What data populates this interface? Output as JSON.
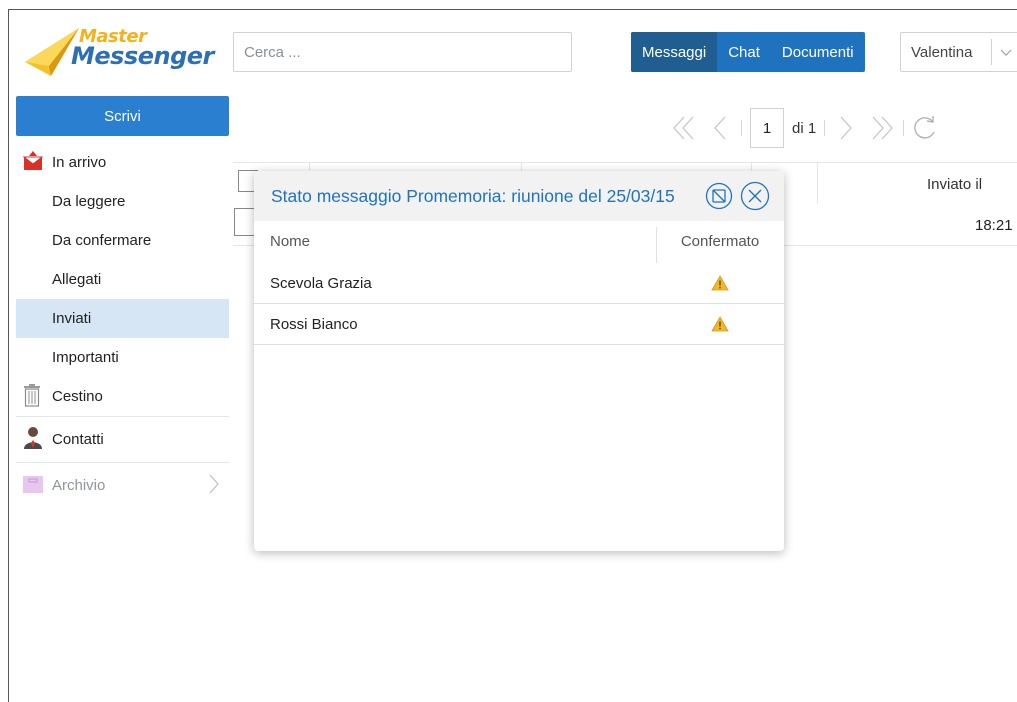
{
  "app": {
    "logo_word1": "Master",
    "logo_word2": "Messenger"
  },
  "search": {
    "placeholder": "Cerca ..."
  },
  "tabs": [
    {
      "label": "Messaggi",
      "active": true
    },
    {
      "label": "Chat",
      "active": false
    },
    {
      "label": "Documenti",
      "active": false
    }
  ],
  "user": {
    "name": "Valentina"
  },
  "sidebar": {
    "compose_label": "Scrivi",
    "items": [
      {
        "label": "In arrivo",
        "icon": "inbox-envelope-icon"
      },
      {
        "label": "Da leggere"
      },
      {
        "label": "Da confermare"
      },
      {
        "label": "Allegati"
      },
      {
        "label": "Inviati",
        "active": true
      },
      {
        "label": "Importanti"
      },
      {
        "label": "Cestino",
        "icon": "trash-icon"
      },
      {
        "label": "Contatti",
        "icon": "contacts-person-icon"
      },
      {
        "label": "Archivio",
        "icon": "archive-folder-icon"
      }
    ]
  },
  "pager": {
    "page": "1",
    "total_label": "di 1"
  },
  "list": {
    "col_sent": "Inviato il",
    "row_time": "18:21"
  },
  "modal": {
    "title": "Stato messaggio Promemoria: riunione del 25/03/15",
    "col_name": "Nome",
    "col_confirmed": "Confermato",
    "rows": [
      {
        "name": "Scevola Grazia",
        "status_icon": "warning-icon"
      },
      {
        "name": "Rossi Bianco",
        "status_icon": "warning-icon"
      }
    ]
  },
  "colors": {
    "primary": "#2b7fd0",
    "tab_active": "#205e92",
    "sidebar_active": "#d6e6f5",
    "warning": "#f1b82d"
  }
}
